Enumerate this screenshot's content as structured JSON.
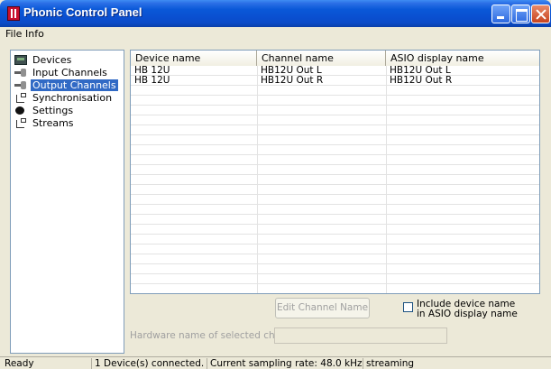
{
  "window": {
    "title": "Phonic Control Panel"
  },
  "menu": {
    "items": [
      "File",
      "Info"
    ]
  },
  "tree": {
    "items": [
      {
        "label": "Devices",
        "icon": "devices-icon",
        "selected": false
      },
      {
        "label": "Input Channels",
        "icon": "plug-icon",
        "selected": false
      },
      {
        "label": "Output Channels",
        "icon": "plug-icon",
        "selected": true
      },
      {
        "label": "Synchronisation",
        "icon": "sync-icon",
        "selected": false
      },
      {
        "label": "Settings",
        "icon": "settings-icon",
        "selected": false
      },
      {
        "label": "Streams",
        "icon": "sync-icon",
        "selected": false
      }
    ]
  },
  "table": {
    "columns": [
      "Device name",
      "Channel name",
      "ASIO display name"
    ],
    "rows": [
      [
        "HB 12U",
        "HB12U Out L",
        "HB12U Out L"
      ],
      [
        "HB 12U",
        "HB12U Out R",
        "HB12U Out R"
      ]
    ]
  },
  "controls": {
    "edit_button": "Edit Channel Name",
    "include_checkbox_label": "Include device name in ASIO display name",
    "include_checked": false,
    "hardware_label": "Hardware name of selected channel:",
    "hardware_value": ""
  },
  "status": {
    "ready": "Ready",
    "devices": "1 Device(s) connected.",
    "sampling": "Current sampling rate: 48.0 kHz",
    "mode": "streaming"
  }
}
